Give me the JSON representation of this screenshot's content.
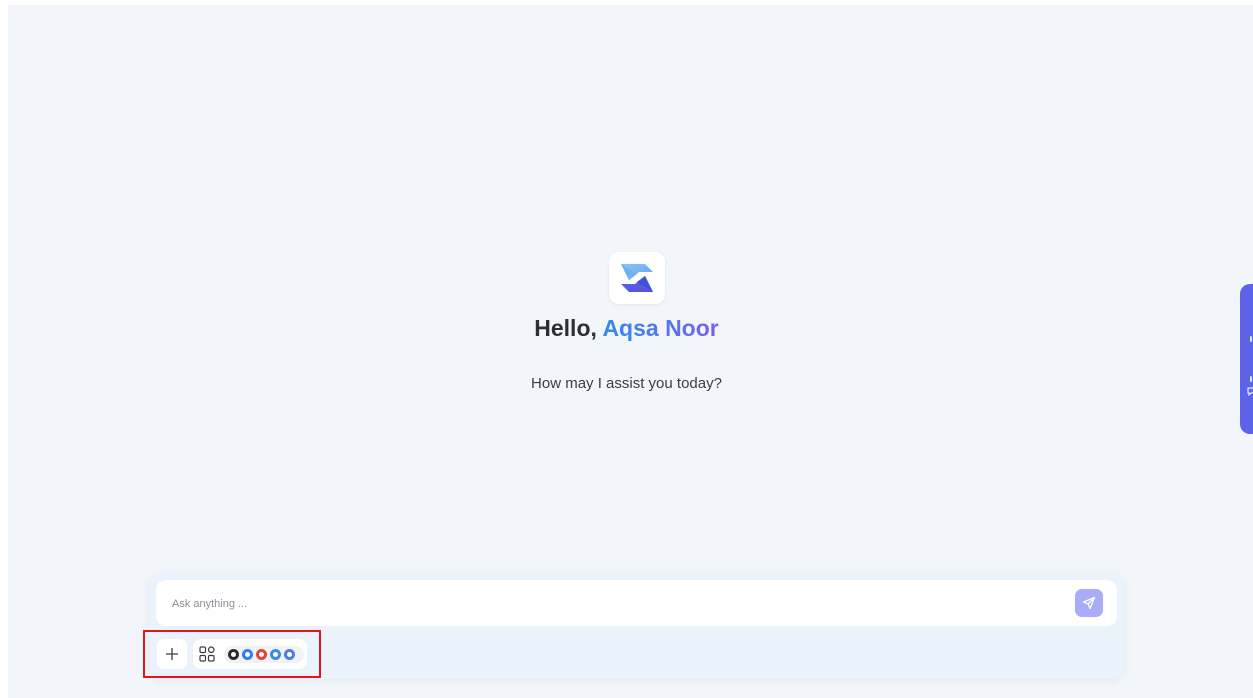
{
  "greeting": {
    "hello": "Hello,",
    "user_name": "Aqsa Noor",
    "subtitle": "How may I assist you today?"
  },
  "composer": {
    "placeholder": "Ask anything ...",
    "attach_icon": "plus-icon",
    "tools_icon": "apps-grid-icon",
    "send_icon": "send-icon",
    "model_icons": [
      "model-icon-dark",
      "model-icon-blue",
      "model-icon-red",
      "model-icon-blue-light",
      "model-icon-blue-swirl"
    ]
  },
  "side_tab": {
    "icon": "feedback-icon"
  },
  "colors": {
    "background": "#f2f6fb",
    "accent": "#5b63ea",
    "send_button": "#a9acf6",
    "name_gradient_start": "#2f8af0",
    "name_gradient_end": "#7a5cf0",
    "highlight": "#e0141c"
  }
}
